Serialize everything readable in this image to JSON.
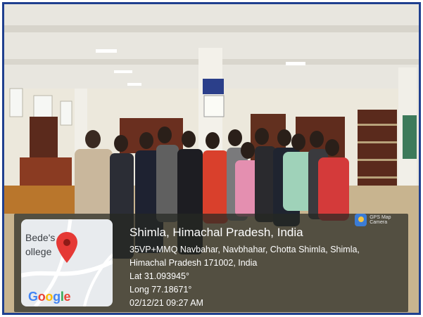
{
  "photo": {
    "description_tag": "group-photo-in-library",
    "sign_text": "E-CATALOGUE"
  },
  "geotag": {
    "badge_label": "GPS Map Camera",
    "title": "Shimla, Himachal Pradesh, India",
    "address_line1": "35VP+MMQ Navbahar, Navbhahar, Chotta Shimla, Shimla,",
    "address_line2": "Himachal Pradesh 171002, India",
    "latitude": "Lat 31.093945°",
    "longitude": "Long 77.18671°",
    "datetime": "02/12/21 09:27 AM"
  },
  "map": {
    "label_line1": "Bede's",
    "label_line2": "ollege",
    "provider": [
      "G",
      "o",
      "o",
      "g",
      "l",
      "e"
    ],
    "provider_colors": [
      "#4285F4",
      "#EA4335",
      "#FBBC05",
      "#4285F4",
      "#34A853",
      "#EA4335"
    ],
    "pin_color": "#e53935"
  },
  "colors": {
    "frame": "#1f3f8f"
  }
}
